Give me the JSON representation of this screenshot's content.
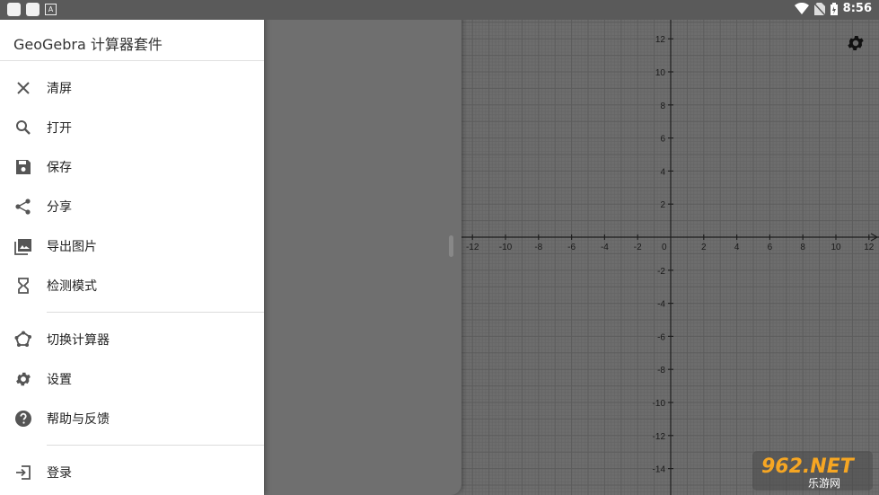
{
  "status_bar": {
    "time": "8:56"
  },
  "drawer": {
    "title": "GeoGebra 计算器套件",
    "items": [
      {
        "label": "清屏",
        "icon": "close-icon"
      },
      {
        "label": "打开",
        "icon": "search-icon"
      },
      {
        "label": "保存",
        "icon": "save-icon"
      },
      {
        "label": "分享",
        "icon": "share-icon"
      },
      {
        "label": "导出图片",
        "icon": "image-icon"
      },
      {
        "label": "检测模式",
        "icon": "hourglass-icon"
      },
      {
        "label": "切换计算器",
        "icon": "polygon-icon"
      },
      {
        "label": "设置",
        "icon": "gear-icon"
      },
      {
        "label": "帮助与反馈",
        "icon": "help-icon"
      },
      {
        "label": "登录",
        "icon": "login-icon"
      }
    ]
  },
  "graph": {
    "x_ticks": [
      "-12",
      "-10",
      "-8",
      "-6",
      "-4",
      "-2",
      "0",
      "2",
      "4",
      "6",
      "8",
      "10",
      "12"
    ],
    "y_ticks": [
      "12",
      "10",
      "8",
      "6",
      "4",
      "2",
      "-2",
      "-4",
      "-6",
      "-8",
      "-10",
      "-12",
      "-14"
    ]
  },
  "watermark": {
    "brand": "962.NET",
    "sub": "乐游网"
  }
}
